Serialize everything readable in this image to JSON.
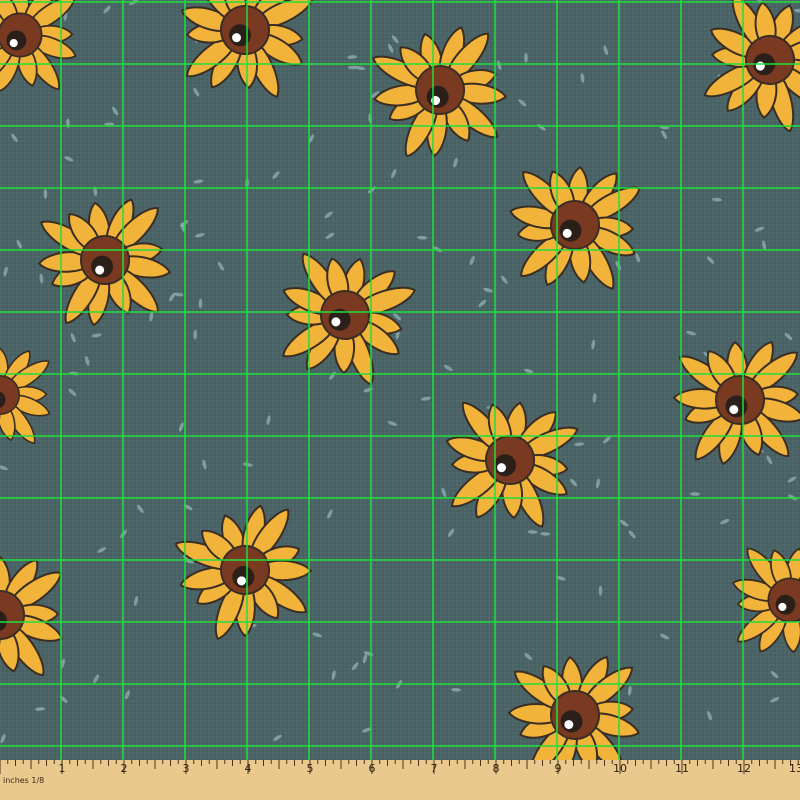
{
  "image": {
    "description_colors": {
      "background": "#4b6468",
      "petal": "#f2b33a",
      "petal_outline": "#3a2e24",
      "center": "#7a3a22",
      "center_dark": "#2b1f1a",
      "grid": "#1fe03a",
      "confetti": "#8fb2b4",
      "ruler": "#e9c98e"
    }
  },
  "ruler": {
    "unit_label": "inches 1/8",
    "numbers": [
      "1",
      "2",
      "3",
      "4",
      "5",
      "6",
      "7",
      "8",
      "9",
      "10",
      "11",
      "12",
      "13"
    ]
  }
}
